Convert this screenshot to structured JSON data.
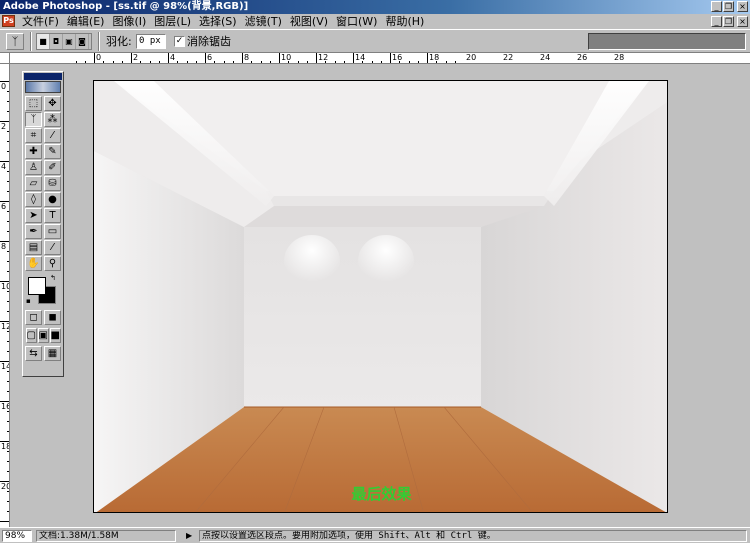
{
  "app": {
    "window_title": "Adobe Photoshop - [ss.tif @ 98%(背景,RGB)]",
    "app_icon_glyph": "Ps",
    "window_buttons": [
      "_",
      "❐",
      "×"
    ],
    "doc_buttons": [
      "_",
      "❐",
      "×"
    ]
  },
  "menu": {
    "items": [
      "文件(F)",
      "编辑(E)",
      "图像(I)",
      "图层(L)",
      "选择(S)",
      "滤镜(T)",
      "视图(V)",
      "窗口(W)",
      "帮助(H)"
    ]
  },
  "options_bar": {
    "tool_preset_icon": "lasso-icon",
    "tool_preset_glyph": "ᛉ",
    "selection_modes": [
      "■",
      "◘",
      "▣",
      "◙"
    ],
    "feather_label": "羽化:",
    "feather_value": "0 px",
    "antialias_checked": true,
    "antialias_check_glyph": "✓",
    "antialias_label": "消除锯齿",
    "palette_well_color": "#808080"
  },
  "rulers": {
    "horizontal_labels": [
      "0",
      "2",
      "4",
      "6",
      "8",
      "10",
      "12",
      "14",
      "16",
      "18",
      "20",
      "22",
      "24",
      "26",
      "28"
    ],
    "vertical_labels": [
      "0",
      "2",
      "4",
      "6",
      "8",
      "10",
      "12",
      "14",
      "16",
      "18",
      "20"
    ]
  },
  "toolbox": {
    "tools": [
      {
        "name": "marquee-icon",
        "glyph": "⬚"
      },
      {
        "name": "move-icon",
        "glyph": "✥"
      },
      {
        "name": "lasso-icon",
        "glyph": "ᛉ"
      },
      {
        "name": "magic-wand-icon",
        "glyph": "⁂"
      },
      {
        "name": "crop-icon",
        "glyph": "⌗"
      },
      {
        "name": "slice-icon",
        "glyph": "⁄"
      },
      {
        "name": "healing-brush-icon",
        "glyph": "✚"
      },
      {
        "name": "brush-icon",
        "glyph": "✎"
      },
      {
        "name": "clone-stamp-icon",
        "glyph": "♙"
      },
      {
        "name": "history-brush-icon",
        "glyph": "✐"
      },
      {
        "name": "eraser-icon",
        "glyph": "▱"
      },
      {
        "name": "paint-bucket-icon",
        "glyph": "⛁"
      },
      {
        "name": "blur-icon",
        "glyph": "◊"
      },
      {
        "name": "dodge-icon",
        "glyph": "●"
      },
      {
        "name": "path-select-icon",
        "glyph": "➤"
      },
      {
        "name": "type-icon",
        "glyph": "T"
      },
      {
        "name": "pen-icon",
        "glyph": "✒"
      },
      {
        "name": "rectangle-icon",
        "glyph": "▭"
      },
      {
        "name": "notes-icon",
        "glyph": "▤"
      },
      {
        "name": "eyedropper-icon",
        "glyph": "⁄"
      },
      {
        "name": "hand-icon",
        "glyph": "✋"
      },
      {
        "name": "zoom-icon",
        "glyph": "⚲"
      }
    ],
    "selected_tool": "lasso-icon",
    "foreground_color": "#ffffff",
    "background_color": "#000000",
    "swap_colors_glyph": "↰",
    "default_colors_glyph": "▪",
    "mask_modes": [
      {
        "name": "standard-mode-icon",
        "glyph": "◻"
      },
      {
        "name": "quick-mask-icon",
        "glyph": "◼"
      }
    ],
    "screen_modes": [
      {
        "name": "standard-screen-icon",
        "glyph": "▢"
      },
      {
        "name": "full-screen-menu-icon",
        "glyph": "▣"
      },
      {
        "name": "full-screen-icon",
        "glyph": "■"
      }
    ],
    "jump_to": [
      {
        "name": "jump-imageready-icon",
        "glyph": "⇆"
      },
      {
        "name": "grid-icon",
        "glyph": "▦"
      }
    ]
  },
  "canvas": {
    "caption": "最后效果",
    "caption_color": "#33cc33"
  },
  "status": {
    "zoom": "98%",
    "doc_info": "文档:1.38M/1.58M",
    "arrow_glyph": "▶",
    "hint": "点按以设置选区段点。要用附加选项，使用 Shift、Alt 和 Ctrl 键。"
  }
}
